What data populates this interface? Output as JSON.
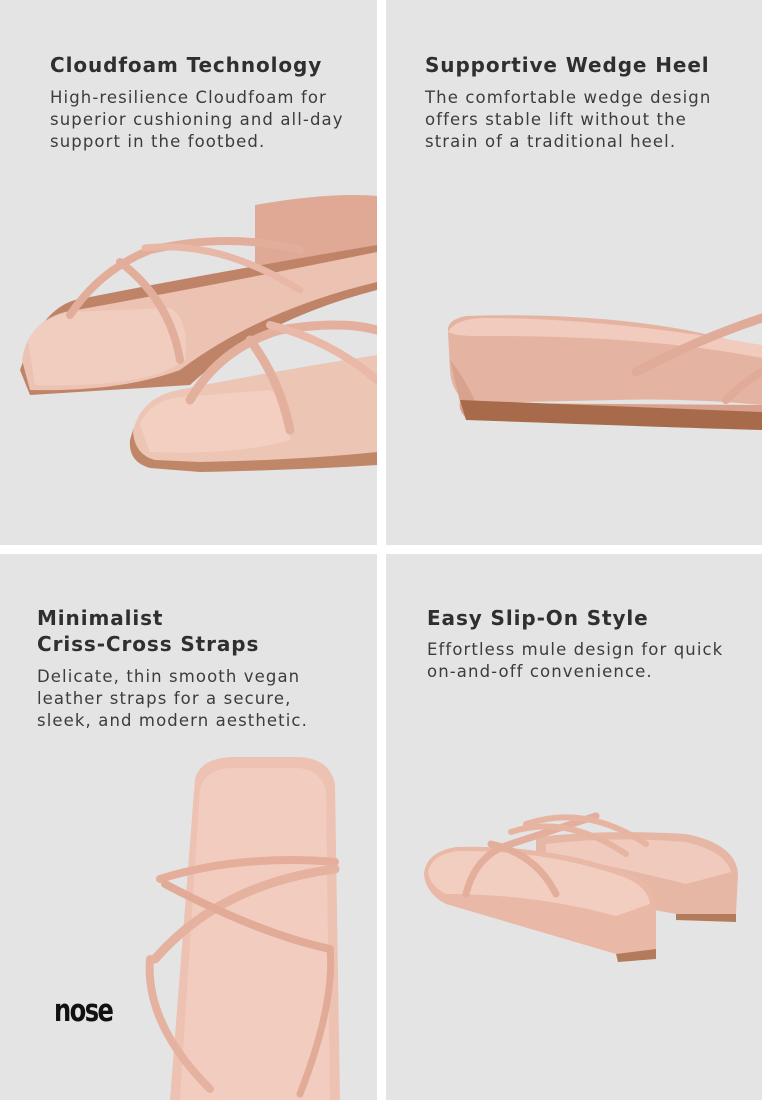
{
  "panels": [
    {
      "title": "Cloudfoam Technology",
      "description": "High-resilience Cloudfoam for\nsuperior cushioning and all-day\nsupport in the footbed."
    },
    {
      "title": "Supportive Wedge Heel",
      "description": "The comfortable wedge design\noffers stable lift without the\nstrain of a traditional heel."
    },
    {
      "title_line1": "Minimalist",
      "title_line2": "Criss-Cross Straps",
      "description": "Delicate, thin smooth vegan\nleather straps for a secure,\nsleek, and modern aesthetic."
    },
    {
      "title": "Easy Slip-On Style",
      "description": "Effortless mule design for quick\non-and-off convenience."
    }
  ],
  "brand": {
    "logo": "nose"
  },
  "colors": {
    "panel_bg": "#e4e4e4",
    "sandal_pink": "#e7b9a9",
    "sole_tan": "#b97e5a"
  }
}
